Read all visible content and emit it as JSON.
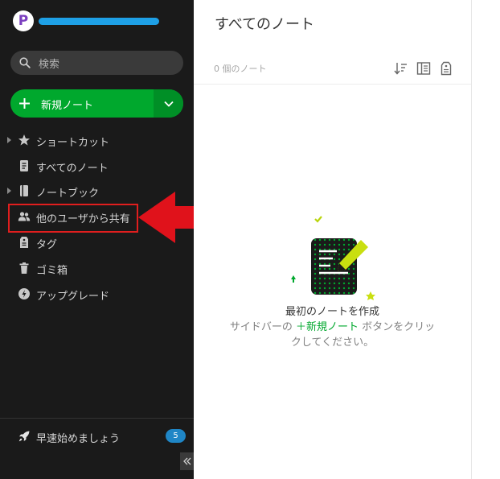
{
  "sidebar": {
    "search_label": "検索",
    "new_note_label": "新規ノート",
    "items": [
      {
        "label": "ショートカット"
      },
      {
        "label": "すべてのノート"
      },
      {
        "label": "ノートブック"
      },
      {
        "label": "他のユーザから共有"
      },
      {
        "label": "タグ"
      },
      {
        "label": "ゴミ箱"
      },
      {
        "label": "アップグレード"
      }
    ],
    "quickstart_label": "早速始めましょう",
    "quickstart_badge": "5",
    "avatar_letter": "P"
  },
  "main": {
    "title": "すべてのノート",
    "note_count": "0 個のノート",
    "empty_title": "最初のノートを作成",
    "empty_desc_before": "サイドバーの ",
    "empty_desc_link": "＋新規ノート",
    "empty_desc_after": " ボタンをクリッ",
    "empty_desc_line2": "クしてください。"
  },
  "colors": {
    "sidebar_bg": "#1a1a1a",
    "accent_green": "#00a82d",
    "highlight_red": "#e01e1e",
    "badge_blue": "#1f86c6",
    "account_bar": "#1ea0e6"
  }
}
